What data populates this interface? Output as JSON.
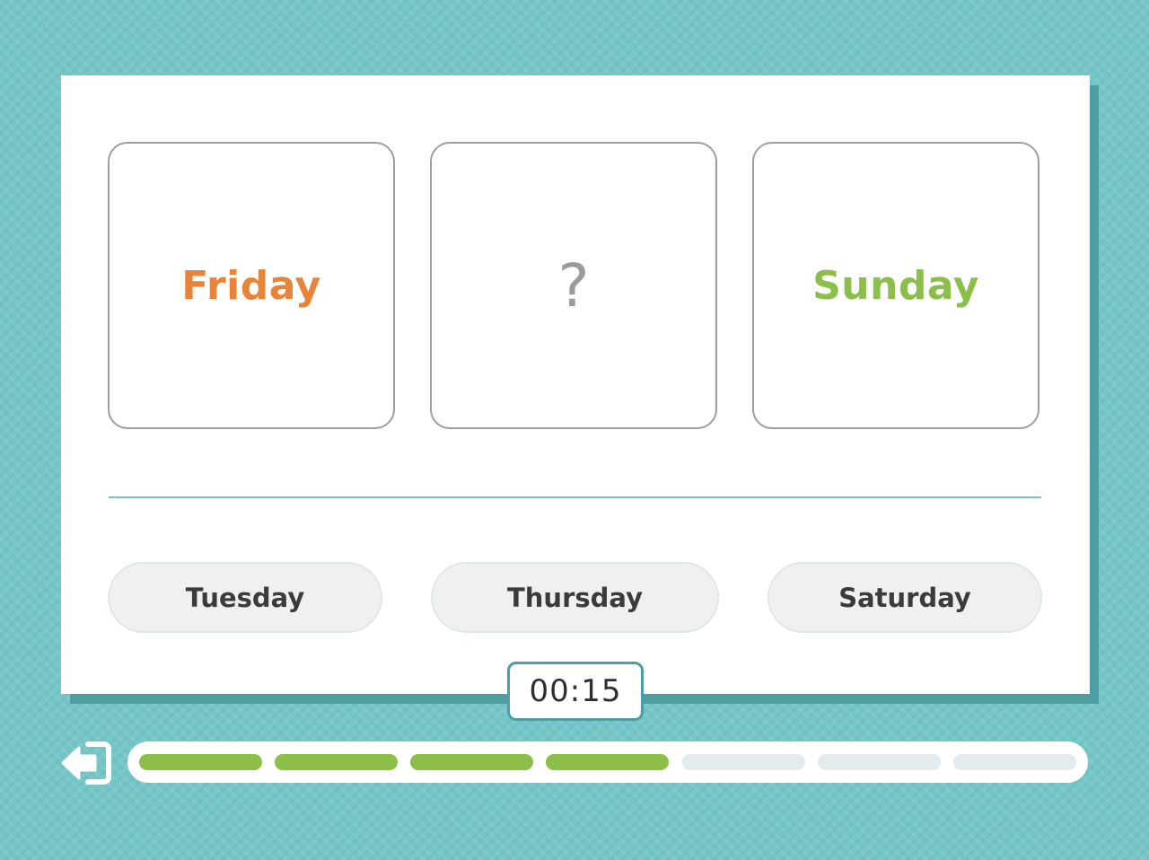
{
  "sequence": {
    "tiles": [
      {
        "text": "Friday",
        "color": "#e8833a"
      },
      {
        "text": "?",
        "color": "#9b9b9b"
      },
      {
        "text": "Sunday",
        "color": "#8cbf49"
      }
    ]
  },
  "answers": {
    "options": [
      {
        "label": "Tuesday"
      },
      {
        "label": "Thursday"
      },
      {
        "label": "Saturday"
      }
    ]
  },
  "timer": {
    "value": "00:15"
  },
  "exit": {
    "icon": "exit-arrow-icon"
  },
  "progress": {
    "total_questions": 7,
    "completed": 4,
    "completed_color": "#8cbf49",
    "remaining_color": "#e4ebef"
  },
  "theme": {
    "background": "#74c6c8",
    "card_shadow": "#4d9ea3",
    "divider": "#78c4c6"
  }
}
